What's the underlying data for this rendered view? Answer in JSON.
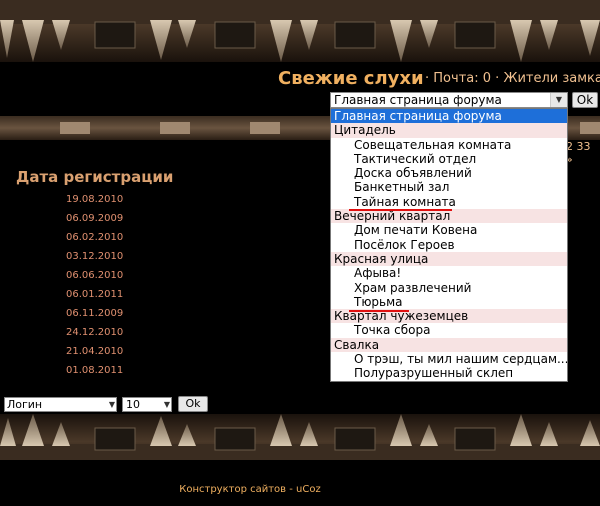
{
  "header": {
    "site_title": "Свежие слухи",
    "mail_label": "Почта: 0",
    "residents_link": "Жители замка",
    "separator": "·"
  },
  "forum_jump": {
    "selected_value": "Главная страница форума",
    "ok_label": "Ok",
    "options": [
      {
        "label": "Главная страница форума",
        "kind": "selected"
      },
      {
        "label": "Цитадель",
        "kind": "group"
      },
      {
        "label": "Совещательная комната",
        "kind": "child"
      },
      {
        "label": "Тактический отдел",
        "kind": "child"
      },
      {
        "label": "Доска объявлений",
        "kind": "child"
      },
      {
        "label": "Банкетный зал",
        "kind": "child"
      },
      {
        "label": "Тайная комната",
        "kind": "child"
      },
      {
        "label": "Вечерний квартал",
        "kind": "group"
      },
      {
        "label": "Дом печати Ковена",
        "kind": "child"
      },
      {
        "label": "Посёлок Героев",
        "kind": "child"
      },
      {
        "label": "Красная улица",
        "kind": "group"
      },
      {
        "label": "Афыва!",
        "kind": "child"
      },
      {
        "label": "Храм развлечений",
        "kind": "child"
      },
      {
        "label": "Тюрьма",
        "kind": "child"
      },
      {
        "label": "Квартал чужеземцев",
        "kind": "group"
      },
      {
        "label": "Точка сбора",
        "kind": "child"
      },
      {
        "label": "Свалка",
        "kind": "group"
      },
      {
        "label": "О трэш, ты мил нашим сердцам...",
        "kind": "child"
      },
      {
        "label": "Полуразрушенный склеп",
        "kind": "child"
      }
    ]
  },
  "pagination": {
    "text": "2 33 »"
  },
  "members": {
    "column_heading": "Дата регистрации",
    "dates": [
      "19.08.2010",
      "06.09.2009",
      "06.02.2010",
      "03.12.2010",
      "06.06.2010",
      "06.01.2011",
      "06.11.2009",
      "24.12.2010",
      "21.04.2010",
      "01.08.2011"
    ]
  },
  "sort_controls": {
    "sort_by": "Логин",
    "per_page": "10",
    "ok_label": "Ok"
  },
  "footer": {
    "text": "Конструктор сайтов - uCoz"
  },
  "colors": {
    "title": "#f0b060",
    "date_text": "#e09070",
    "selected_option_bg": "#1e6fd9",
    "group_option_bg": "#f7e3e3",
    "annotation_underline": "#e01010"
  }
}
